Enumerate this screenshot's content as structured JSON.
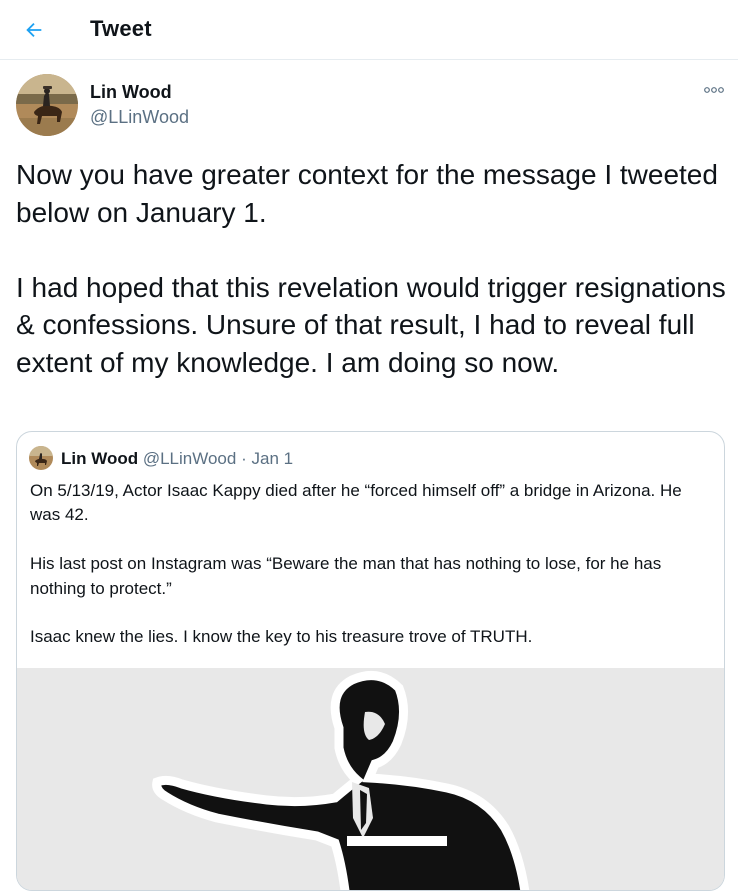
{
  "header": {
    "title": "Tweet",
    "back_icon": "arrow-left-icon"
  },
  "tweet": {
    "author": {
      "name": "Lin Wood",
      "handle": "@LLinWood",
      "avatar": "avatar-horse-rider"
    },
    "more_icon": "more-options-icon",
    "text": "Now you have greater context for the message I tweeted below on January 1.\n\nI had hoped that this revelation would trigger resignations & confessions. Unsure of that result, I had to reveal full extent of my knowledge. I am doing so now."
  },
  "quoted_tweet": {
    "author": {
      "name": "Lin Wood",
      "handle": "@LLinWood"
    },
    "separator": "·",
    "date": "Jan 1",
    "text": "On 5/13/19, Actor Isaac Kappy died after he “forced himself off” a bridge in Arizona. He was 42.\n\nHis last post on Instagram was “Beware the man that has nothing to lose, for he has nothing to protect.”\n\nIsaac knew the lies. I know the key to his treasure trove of TRUTH.",
    "media": "silhouette-man-pointing-at-podium"
  },
  "colors": {
    "accent": "#1da1f2",
    "secondary_text": "#5b7083",
    "border": "#ccd6dd"
  }
}
